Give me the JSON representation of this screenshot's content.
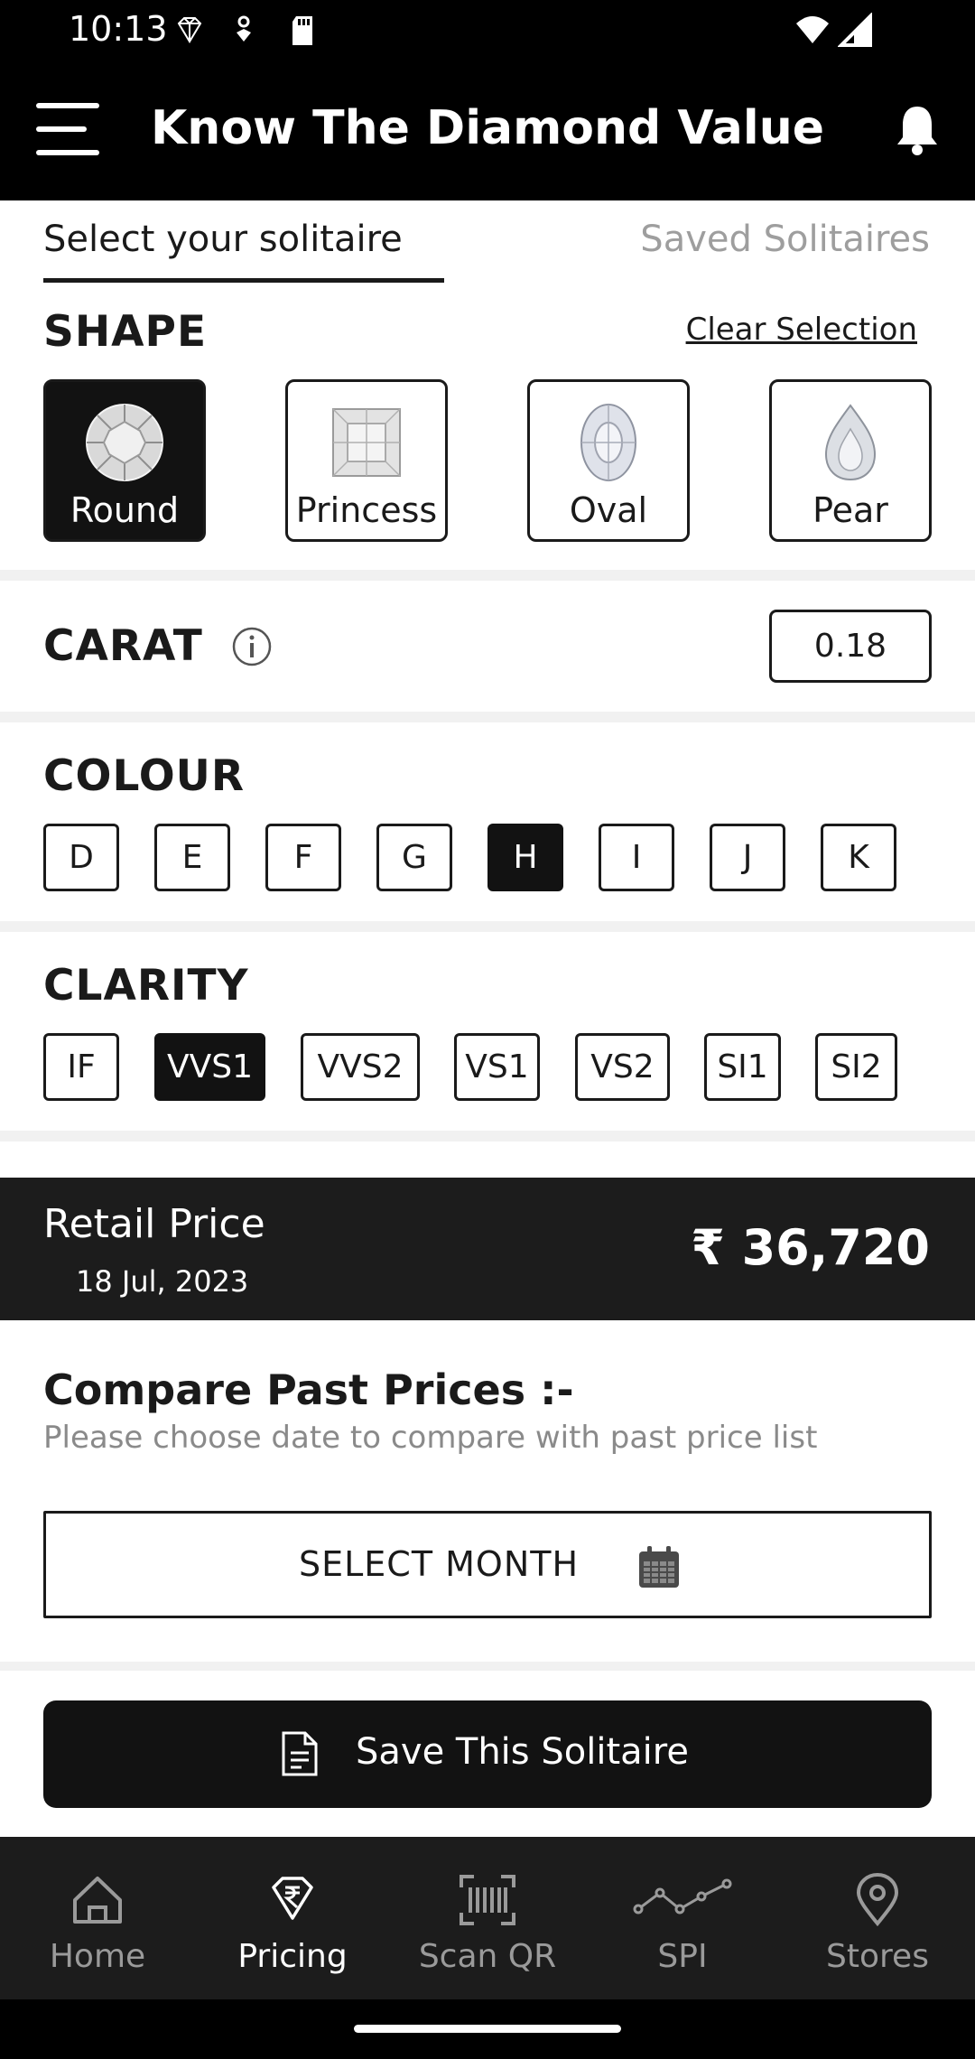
{
  "status_bar": {
    "time": "10:13"
  },
  "app_bar": {
    "title": "Know The Diamond Value"
  },
  "tabs": {
    "active": "Select your solitaire",
    "inactive": "Saved Solitaires"
  },
  "shape": {
    "title": "SHAPE",
    "clear_label": "Clear Selection",
    "options": [
      {
        "label": "Round",
        "selected": true
      },
      {
        "label": "Princess",
        "selected": false
      },
      {
        "label": "Oval",
        "selected": false
      },
      {
        "label": "Pear",
        "selected": false
      }
    ]
  },
  "carat": {
    "title": "CARAT",
    "value": "0.18"
  },
  "colour": {
    "title": "COLOUR",
    "options": [
      "D",
      "E",
      "F",
      "G",
      "H",
      "I",
      "J",
      "K"
    ],
    "selected": "H"
  },
  "clarity": {
    "title": "CLARITY",
    "options": [
      "IF",
      "VVS1",
      "VVS2",
      "VS1",
      "VS2",
      "SI1",
      "SI2"
    ],
    "selected": "VVS1"
  },
  "price": {
    "label": "Retail Price",
    "date": "18 Jul, 2023",
    "value": "₹ 36,720"
  },
  "compare": {
    "title": "Compare Past Prices :-",
    "subtitle": "Please choose date to compare with past price list",
    "button": "SELECT MONTH"
  },
  "save_button": "Save This Solitaire",
  "bottom_nav": [
    {
      "label": "Home",
      "icon": "home-icon",
      "active": false
    },
    {
      "label": "Pricing",
      "icon": "rupee-diamond-icon",
      "active": true
    },
    {
      "label": "Scan QR",
      "icon": "barcode-scan-icon",
      "active": false
    },
    {
      "label": "SPI",
      "icon": "line-graph-icon",
      "active": false
    },
    {
      "label": "Stores",
      "icon": "location-pin-icon",
      "active": false
    }
  ],
  "colors": {
    "dark": "#121212",
    "accent_bg": "#1c1c1c",
    "muted": "#9e9e9e"
  }
}
